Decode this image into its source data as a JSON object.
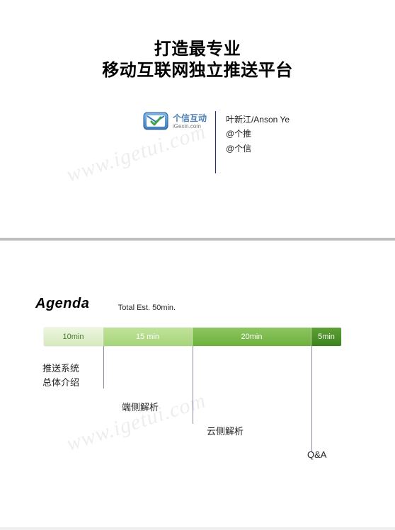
{
  "slide1": {
    "title_line1": "打造最专业",
    "title_line2": "移动互联网独立推送平台",
    "logo_cn": "个信互动",
    "logo_en": "iGexin.com",
    "author_name": "叶新江/Anson Ye",
    "author_handle1": "@个推",
    "author_handle2": "@个信",
    "watermark": "www.igetui.com"
  },
  "slide2": {
    "heading": "Agenda",
    "subheading": "Total Est. 50min.",
    "segments": [
      {
        "label": "10min"
      },
      {
        "label": "15 min"
      },
      {
        "label": "20min"
      },
      {
        "label": "5min"
      }
    ],
    "items": {
      "intro_line1": "推送系统",
      "intro_line2": "总体介绍",
      "client": "端侧解析",
      "cloud": "云侧解析",
      "qa": "Q&A"
    },
    "watermark": "www.igetui.com"
  }
}
